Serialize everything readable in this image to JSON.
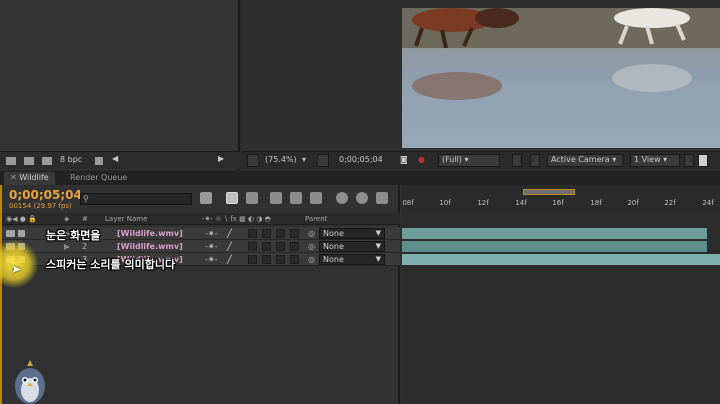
{
  "project_panel": {
    "bpc_label": "8 bpc"
  },
  "comp_toolbar": {
    "zoom": "(75.4%)",
    "timecode": "0;00;05;04",
    "resolution": "(Full)",
    "camera": "Active Camera",
    "view": "1 View"
  },
  "timeline": {
    "tabs": [
      {
        "label": "Wildlife"
      },
      {
        "label": "Render Queue"
      }
    ],
    "timecode": "0;00;05;04",
    "fps_info": "00154 (29.97 fps)",
    "search_placeholder": "",
    "columns": {
      "layer_name": "Layer Name",
      "parent": "Parent"
    },
    "layers": [
      {
        "name": "[Wildlife.wmv]",
        "number": "1",
        "parent": "None"
      },
      {
        "name": "[Wildlife.wmv]",
        "number": "2",
        "parent": "None"
      },
      {
        "name": "[Wildlife.wmv]",
        "number": "3",
        "parent": "None"
      }
    ],
    "ruler_ticks": [
      "08f",
      "10f",
      "12f",
      "14f",
      "16f",
      "18f",
      "20f",
      "22f",
      "24f"
    ]
  },
  "captions": {
    "line1": "눈은 화면을",
    "line2": "스피커는 소리를 의미합니다"
  },
  "colors": {
    "timecode": "#e8a33a",
    "layer_bar": "#6e9e9c",
    "layer_name": "#d8a0c8",
    "cursor_highlight": "#f5dc3c"
  }
}
